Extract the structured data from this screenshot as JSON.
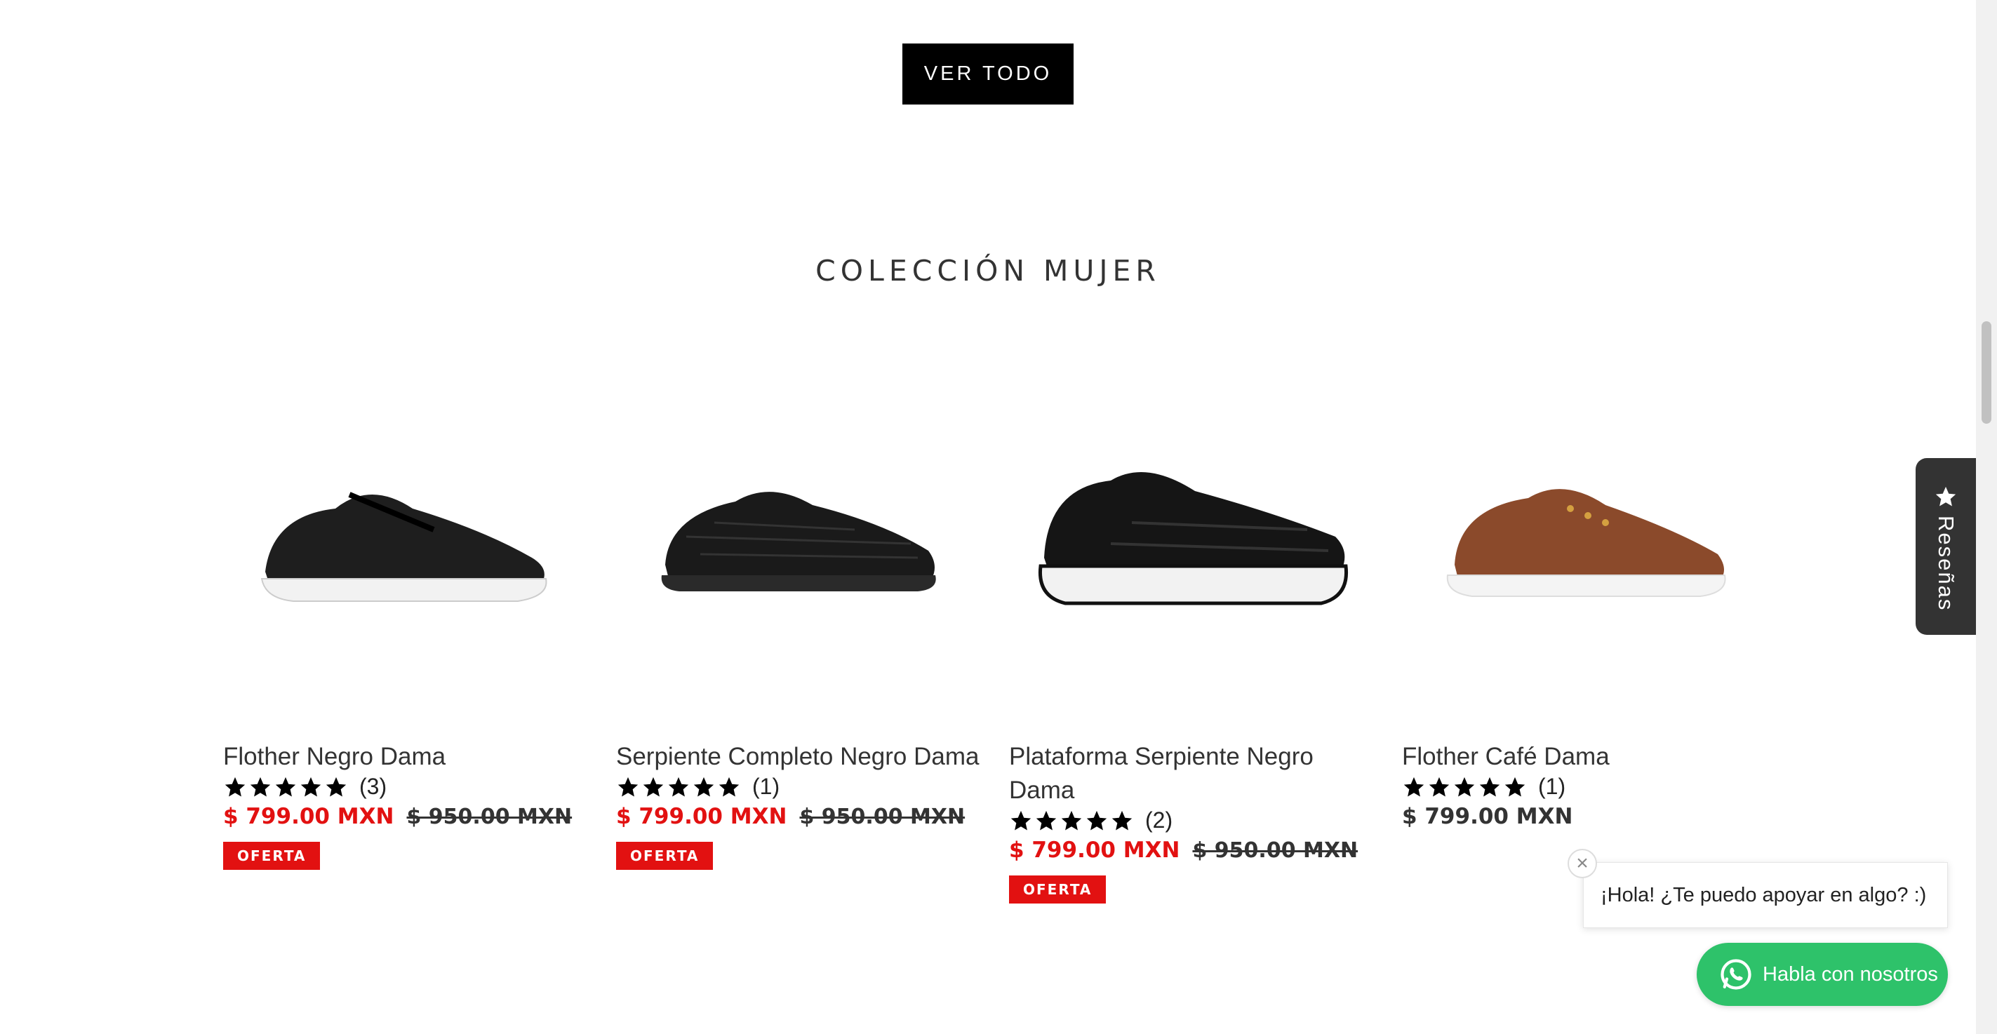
{
  "cta": {
    "ver_todo": "VER TODO"
  },
  "section": {
    "title": "COLECCIÓN MUJER"
  },
  "products": [
    {
      "title": "Flother Negro Dama",
      "stars": 5,
      "review_count": "(3)",
      "price": "$ 799.00 MXN",
      "compare_price": "$ 950.00 MXN",
      "badge": "OFERTA",
      "on_sale": true,
      "shoe_color": "#1e1e1e",
      "sole_color": "#f2f2f2"
    },
    {
      "title": "Serpiente Completo Negro Dama",
      "stars": 5,
      "review_count": "(1)",
      "price": "$ 799.00 MXN",
      "compare_price": "$ 950.00 MXN",
      "badge": "OFERTA",
      "on_sale": true,
      "shoe_color": "#1a1a1a",
      "sole_color": "#2a2a2a"
    },
    {
      "title": "Plataforma Serpiente Negro Dama",
      "stars": 5,
      "review_count": "(2)",
      "price": "$ 799.00 MXN",
      "compare_price": "$ 950.00 MXN",
      "badge": "OFERTA",
      "on_sale": true,
      "shoe_color": "#151515",
      "sole_color": "#f2f2f2"
    },
    {
      "title": "Flother Café Dama",
      "stars": 5,
      "review_count": "(1)",
      "price": "$ 799.00 MXN",
      "on_sale": false,
      "shoe_color": "#8b4a2b",
      "sole_color": "#f4f4f4"
    }
  ],
  "reviews_tab": {
    "label": "Reseñas",
    "icon": "star-icon"
  },
  "chat": {
    "greeting": "¡Hola! ¿Te puedo apoyar en algo? :)",
    "button_label": "Habla con nosotros",
    "icon": "whatsapp-icon"
  },
  "colors": {
    "sale_red": "#e21111",
    "whatsapp_green": "#2ec26a",
    "reviews_tab_bg": "#333333"
  }
}
